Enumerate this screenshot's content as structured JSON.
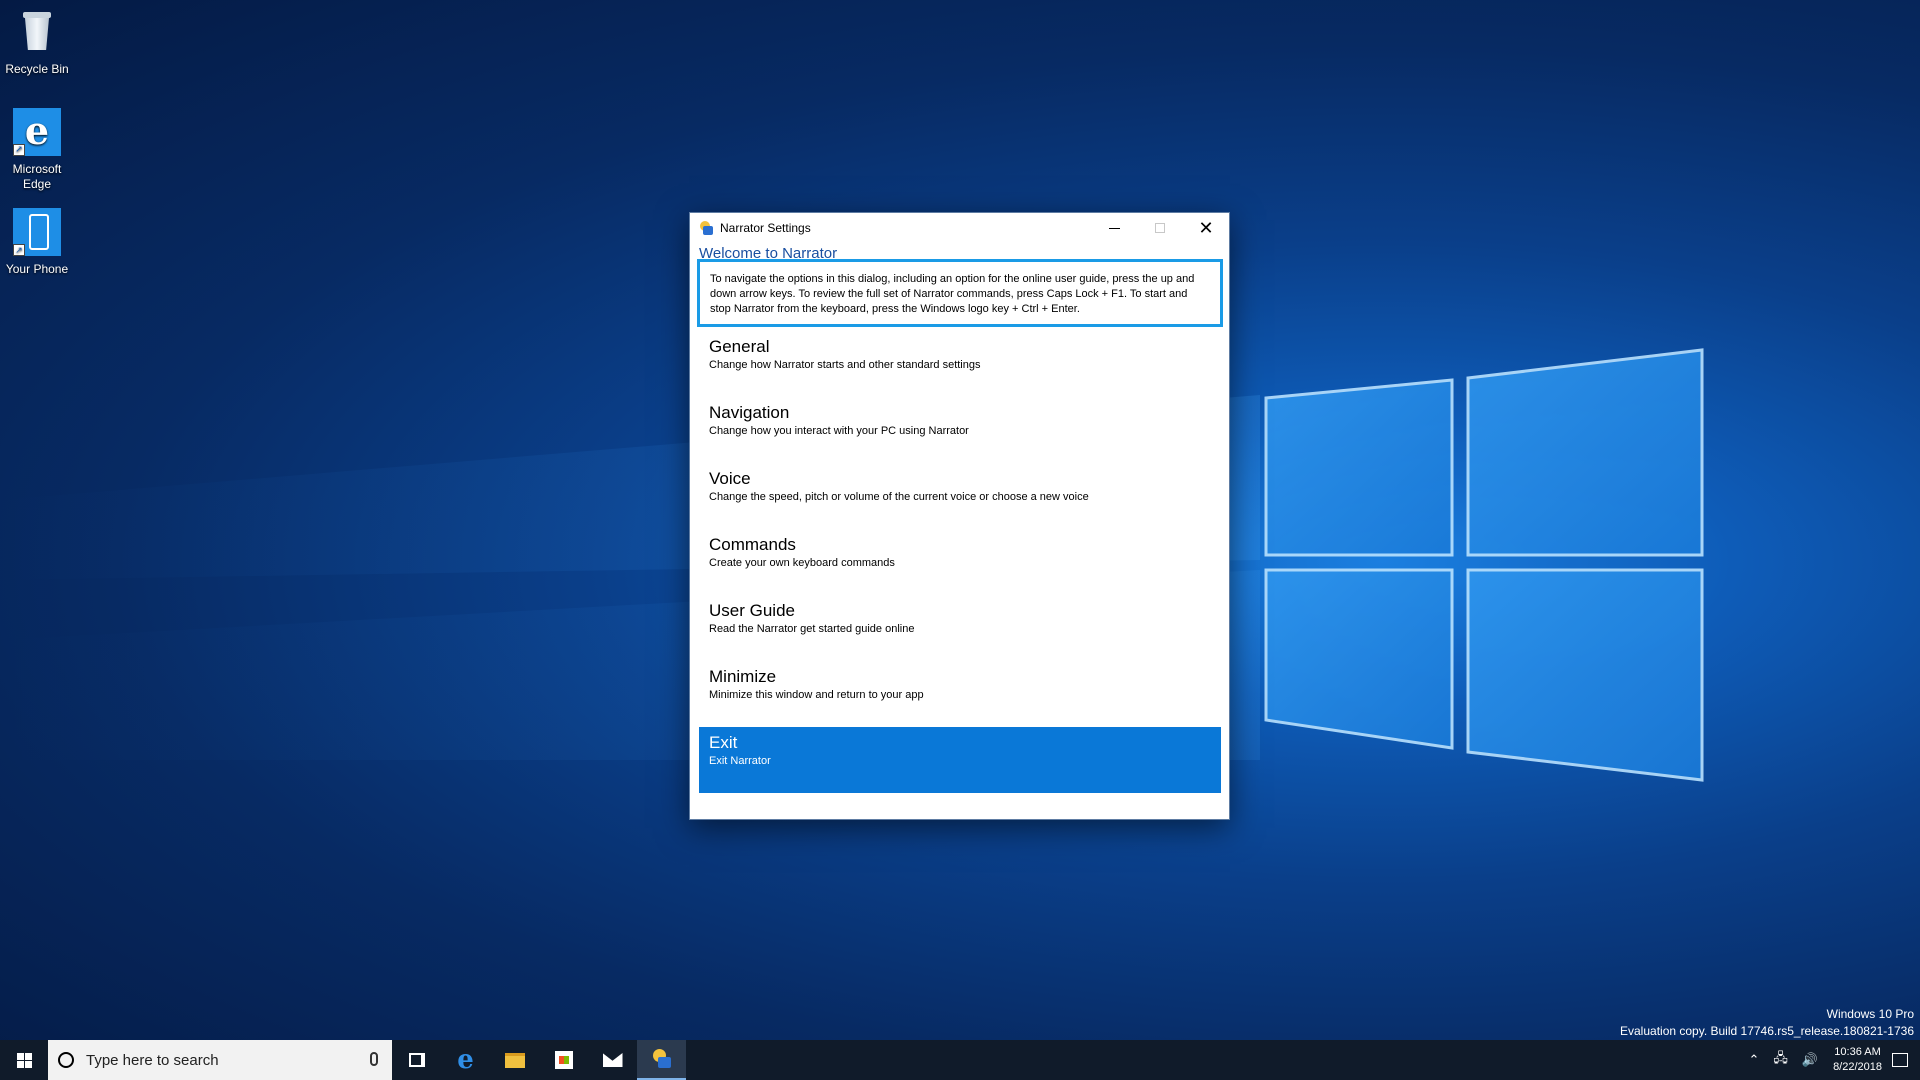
{
  "desktop": {
    "icons": [
      {
        "label": "Recycle Bin",
        "icon": "recycle-bin-icon"
      },
      {
        "label": "Microsoft Edge",
        "icon": "edge-icon"
      },
      {
        "label": "Your Phone",
        "icon": "phone-icon"
      }
    ]
  },
  "dialog": {
    "title": "Narrator Settings",
    "welcome": "Welcome to Narrator",
    "intro": "To navigate the options in this dialog, including an option for the online user guide, press the up and down arrow keys. To review the full set of Narrator commands, press Caps Lock + F1. To start and stop Narrator from the keyboard, press the Windows logo key + Ctrl + Enter.",
    "items": [
      {
        "label": "General",
        "desc": "Change how Narrator starts and other standard settings"
      },
      {
        "label": "Navigation",
        "desc": "Change how you interact with your PC using Narrator"
      },
      {
        "label": "Voice",
        "desc": "Change the speed, pitch or volume of the current voice or choose a new voice"
      },
      {
        "label": "Commands",
        "desc": "Create your own keyboard commands"
      },
      {
        "label": "User Guide",
        "desc": "Read the Narrator get started guide online"
      },
      {
        "label": "Minimize",
        "desc": "Minimize this window and return to your app"
      },
      {
        "label": "Exit",
        "desc": "Exit Narrator"
      }
    ],
    "selected_item": "Exit",
    "accent_color": "#0a78d7",
    "focus_color": "#1a9be6"
  },
  "watermark": {
    "line1": "Windows 10 Pro",
    "line2": "Evaluation copy. Build 17746.rs5_release.180821-1736"
  },
  "taskbar": {
    "search_placeholder": "Type here to search",
    "pinned": [
      "task-view-icon",
      "edge-icon",
      "file-explorer-icon",
      "store-icon",
      "mail-icon",
      "narrator-icon"
    ],
    "clock_time": "10:36 AM",
    "clock_date": "8/22/2018",
    "tray_icons": [
      "chevron-up-icon",
      "network-icon",
      "volume-icon",
      "action-center-icon"
    ]
  }
}
